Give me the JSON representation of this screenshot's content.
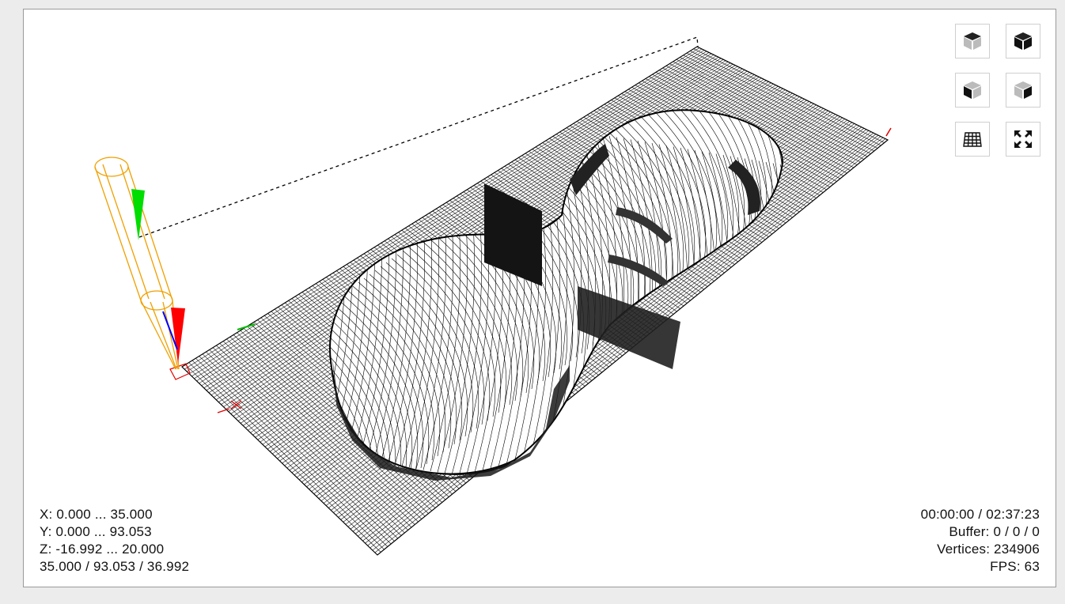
{
  "bounds": {
    "x_range": "X: 0.000 ... 35.000",
    "y_range": "Y: 0.000 ... 93.053",
    "z_range": "Z: -16.992 ... 20.000",
    "size": "35.000 / 93.053 / 36.992"
  },
  "status": {
    "time": "00:00:00 / 02:37:23",
    "buffer": "Buffer: 0 / 0 / 0",
    "vertices": "Vertices: 234906",
    "fps": "FPS: 63"
  },
  "toolbar": {
    "buttons": [
      {
        "name": "view-front-button",
        "icon": "cube-front-icon"
      },
      {
        "name": "view-back-button",
        "icon": "cube-back-icon"
      },
      {
        "name": "view-left-button",
        "icon": "cube-left-icon"
      },
      {
        "name": "view-right-button",
        "icon": "cube-right-icon"
      },
      {
        "name": "view-isometric-button",
        "icon": "grid-icon"
      },
      {
        "name": "fit-view-button",
        "icon": "expand-icon"
      }
    ]
  },
  "colors": {
    "background": "#ffffff",
    "mesh": "#000000",
    "tool": "#f0a000",
    "axis_x": "#ff0000",
    "axis_y": "#00cc00",
    "axis_z": "#0000ff"
  }
}
